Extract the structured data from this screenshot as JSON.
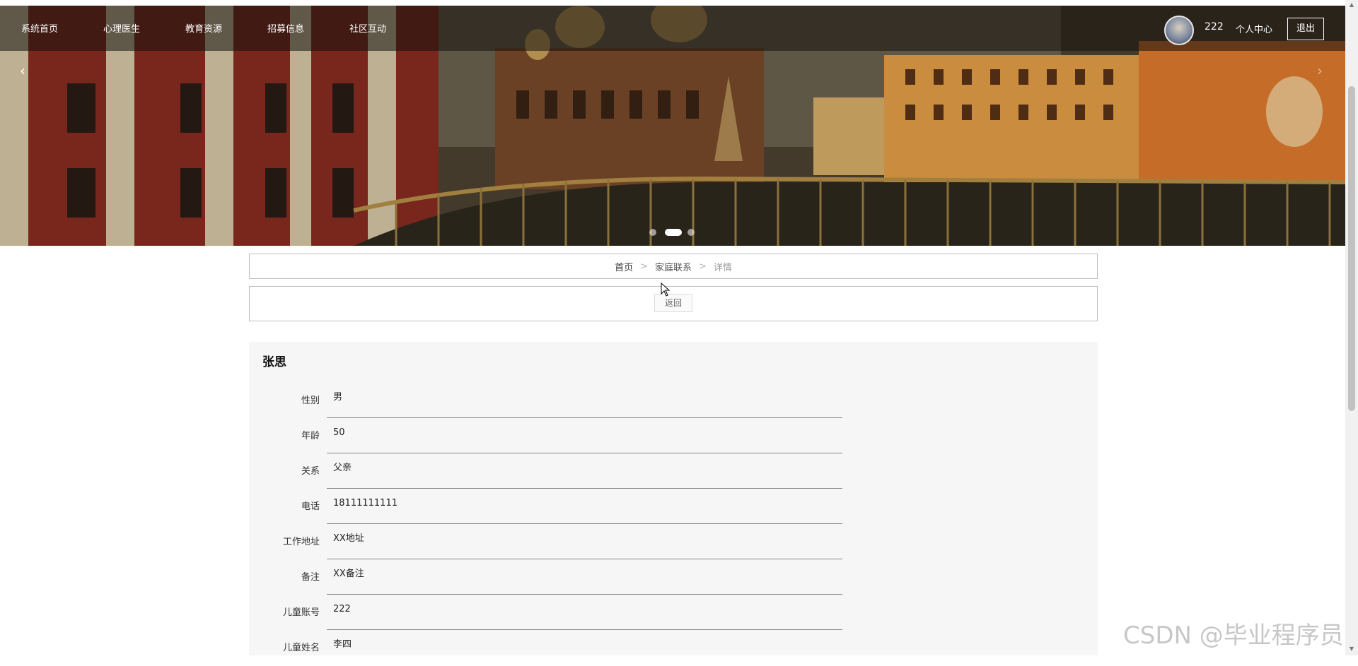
{
  "nav": {
    "items": [
      {
        "label": "系统首页"
      },
      {
        "label": "心理医生"
      },
      {
        "label": "教育资源"
      },
      {
        "label": "招募信息"
      },
      {
        "label": "社区互动"
      }
    ],
    "username": "222",
    "center_label": "个人中心",
    "logout_label": "退出"
  },
  "carousel": {
    "prev_icon": "‹",
    "next_icon": "›",
    "slide_count": 3,
    "active_slide": 2
  },
  "breadcrumb": {
    "home": "首页",
    "section": "家庭联系",
    "current": "详情",
    "separator": ">"
  },
  "back_label": "返回",
  "detail": {
    "title": "张思",
    "fields": [
      {
        "label": "性别",
        "value": "男"
      },
      {
        "label": "年龄",
        "value": "50"
      },
      {
        "label": "关系",
        "value": "父亲"
      },
      {
        "label": "电话",
        "value": "18111111111"
      },
      {
        "label": "工作地址",
        "value": "XX地址"
      },
      {
        "label": "备注",
        "value": "XX备注"
      },
      {
        "label": "儿童账号",
        "value": "222"
      },
      {
        "label": "儿童姓名",
        "value": "李四"
      }
    ]
  },
  "watermark": "CSDN @毕业程序员"
}
